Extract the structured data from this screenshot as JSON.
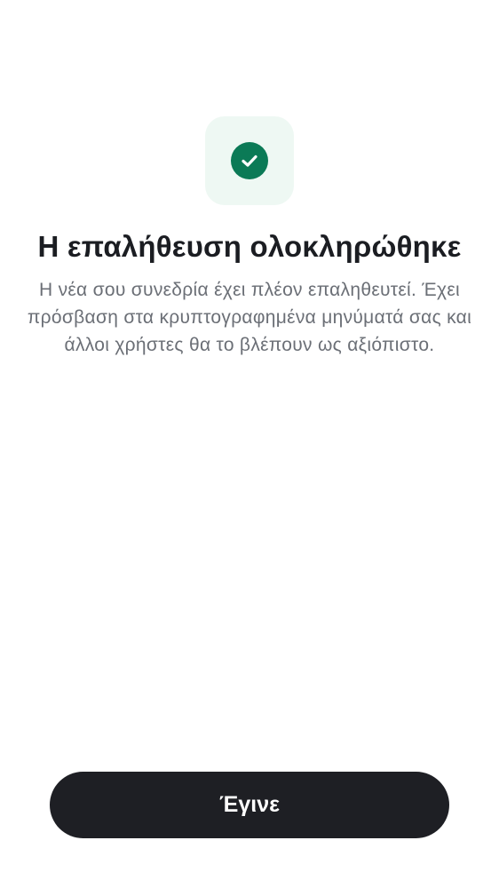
{
  "status_icon": {
    "name": "check-circle-icon",
    "badge_color": "#eef8f3",
    "circle_color": "#0b7a56"
  },
  "title": "Η επαλήθευση ολοκληρώθηκε",
  "description": "Η νέα σου συνεδρία έχει πλέον επαληθευτεί. Έχει πρόσβαση στα κρυπτογραφημένα μηνύματά σας και άλλοι χρήστες θα το βλέπουν ως αξιόπιστο.",
  "done_button": {
    "label": "Έγινε",
    "color": "#1e1f24"
  }
}
